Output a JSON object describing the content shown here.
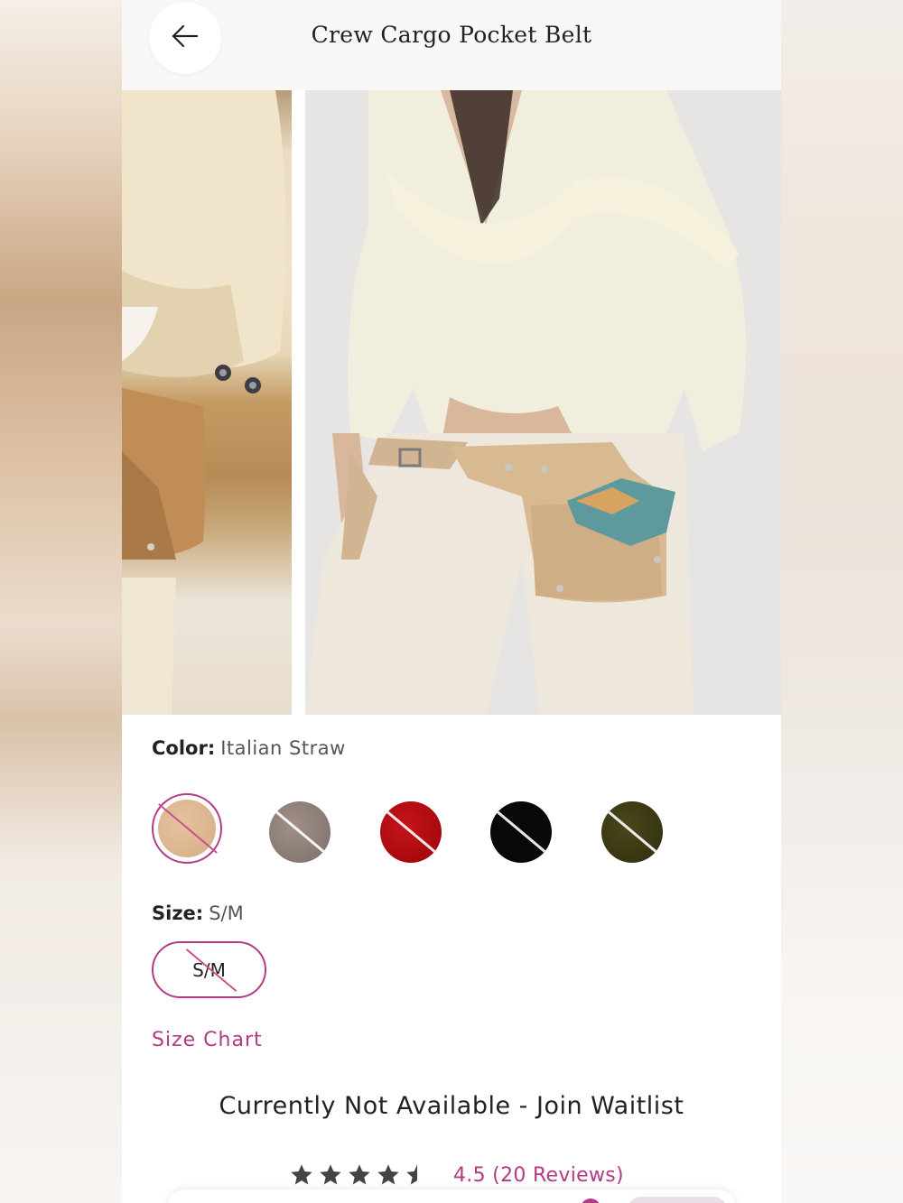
{
  "header": {
    "title": "Crew Cargo Pocket Belt",
    "back_icon": "arrow-left-icon"
  },
  "gallery": {
    "images": [
      "product-detail-photo",
      "product-model-photo"
    ]
  },
  "color": {
    "label": "Color:",
    "selected": "Italian Straw",
    "swatches": [
      {
        "name": "Italian Straw",
        "hex": "#dcb28b",
        "selected": true,
        "unavailable": true
      },
      {
        "name": "taupe",
        "hex": "#8d7e78",
        "unavailable": true
      },
      {
        "name": "red",
        "hex": "#b2070e",
        "unavailable": true
      },
      {
        "name": "black",
        "hex": "#080808",
        "unavailable": true
      },
      {
        "name": "olive",
        "hex": "#3c3a14",
        "unavailable": true
      }
    ]
  },
  "size": {
    "label": "Size:",
    "selected": "S/M",
    "options": [
      {
        "label": "S/M",
        "unavailable": true
      }
    ]
  },
  "size_chart_label": "Size Chart",
  "waitlist_label": "Currently Not Available - Join Waitlist",
  "rating": {
    "stars": 4.5,
    "text": "4.5 (20 Reviews)"
  },
  "colors": {
    "accent": "#b43a83",
    "text": "#222222"
  }
}
